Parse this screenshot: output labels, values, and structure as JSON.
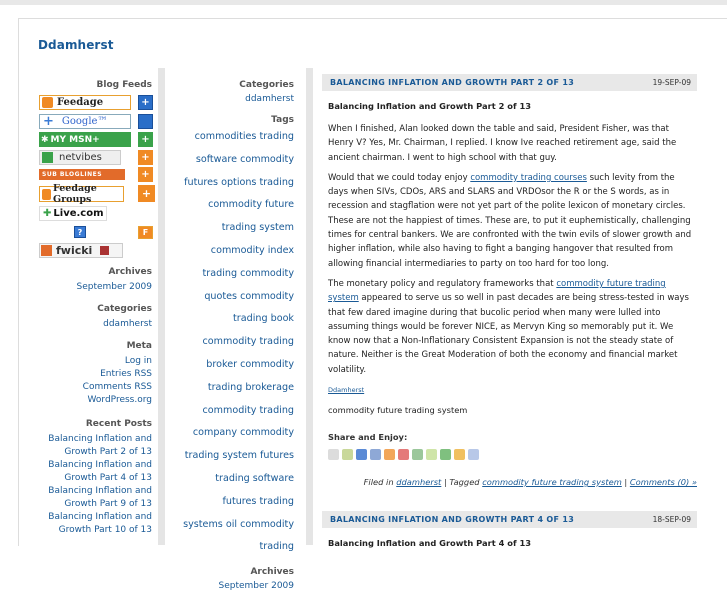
{
  "site": {
    "title": "Ddamherst"
  },
  "sidebar1": {
    "blog_feeds_heading": "Blog Feeds",
    "feeds": [
      {
        "label": "Feedage"
      },
      {
        "label": "Google™"
      },
      {
        "label": "MY MSN+"
      },
      {
        "label": "netvibes"
      },
      {
        "label": "SUB BLOGLINES"
      },
      {
        "label": "Feedage Groups"
      },
      {
        "label": "Live.com"
      },
      {
        "label": "fwicki"
      }
    ],
    "archives_heading": "Archives",
    "archives_link": "September 2009",
    "categories_heading": "Categories",
    "categories_link": "ddamherst",
    "meta_heading": "Meta",
    "meta_links": [
      "Log in",
      "Entries RSS",
      "Comments RSS",
      "WordPress.org"
    ],
    "recent_heading": "Recent Posts",
    "recent_lines": [
      "Balancing Inflation and",
      "Growth Part 2 of 13",
      "Balancing Inflation and",
      "Growth Part 4 of 13",
      "Balancing Inflation and",
      "Growth Part 9 of 13",
      "Balancing Inflation and",
      "Growth Part 10 of 13"
    ]
  },
  "sidebar2": {
    "categories_heading": "Categories",
    "categories_link": "ddamherst",
    "tags_heading": "Tags",
    "tag_lines": [
      "commodities trading",
      "software  commodity",
      "futures options trading",
      "commodity future",
      "trading system",
      "commodity index",
      "trading  commodity",
      "quotes  commodity",
      "trading book",
      "commodity trading",
      "broker  commodity",
      "trading brokerage",
      "commodity trading",
      "company  commodity",
      "trading system  futures",
      "trading software",
      "futures trading",
      "systems  oil commodity",
      "trading"
    ],
    "archives_heading": "Archives",
    "archives_link": "September 2009"
  },
  "post1": {
    "title_bar": "BALANCING INFLATION AND GROWTH PART 2 OF 13",
    "date": "19-SEP-09",
    "subtitle": "Balancing Inflation and Growth Part 2 of 13",
    "p1": "When I finished, Alan looked down the table and said, President Fisher, was that Henry V? Yes, Mr. Chairman, I replied. I know Ive reached retirement age, said the ancient chairman. I went to high school with that guy.",
    "p2_before": "Would that we could today enjoy ",
    "p2_link": "commodity trading courses",
    "p2_after": " such levity from the days when SIVs, CDOs, ARS and SLARS and VRDOsor the R or the S words, as in recession and stagflation were not yet part of the polite lexicon of monetary circles. These are not the happiest of times. These are, to put it euphemistically, challenging times for central bankers. We are confronted with the twin evils of slower growth and higher inflation, while also having to fight a banging hangover that resulted from allowing financial intermediaries to party on too hard for too long.",
    "p3_before": "The monetary policy and regulatory frameworks that ",
    "p3_link": "commodity future trading system",
    "p3_after": " appeared to serve us so well in past decades are being stress-tested in ways that few dared imagine during that bucolic period when many were lulled into assuming things would be forever NICE, as Mervyn King so memorably put it. We know now that a Non-Inflationary Consistent Expansion is not the steady state of nature. Neither is the Great Moderation of both the economy and financial market volatility.",
    "author_link": "Ddamherst",
    "tags_text": "commodity future trading system",
    "share_label": "Share and Enjoy:",
    "share_icons": [
      "digg-icon",
      "bz-icon",
      "delicious-icon",
      "facebook-icon",
      "blogger-icon",
      "myspace-icon",
      "evernote-icon",
      "technorati-icon",
      "stumble-icon",
      "yahoo-icon",
      "google-icon"
    ],
    "filed_prefix": "Filed in ",
    "filed_cat": "ddamherst",
    "filed_mid": " | Tagged ",
    "filed_tag": "commodity future trading system",
    "filed_sep": " | ",
    "filed_comments": "Comments (0) »"
  },
  "post2": {
    "title_bar": "BALANCING INFLATION AND GROWTH PART 4 OF 13",
    "date": "18-SEP-09",
    "subtitle": "Balancing Inflation and Growth Part 4 of 13"
  }
}
